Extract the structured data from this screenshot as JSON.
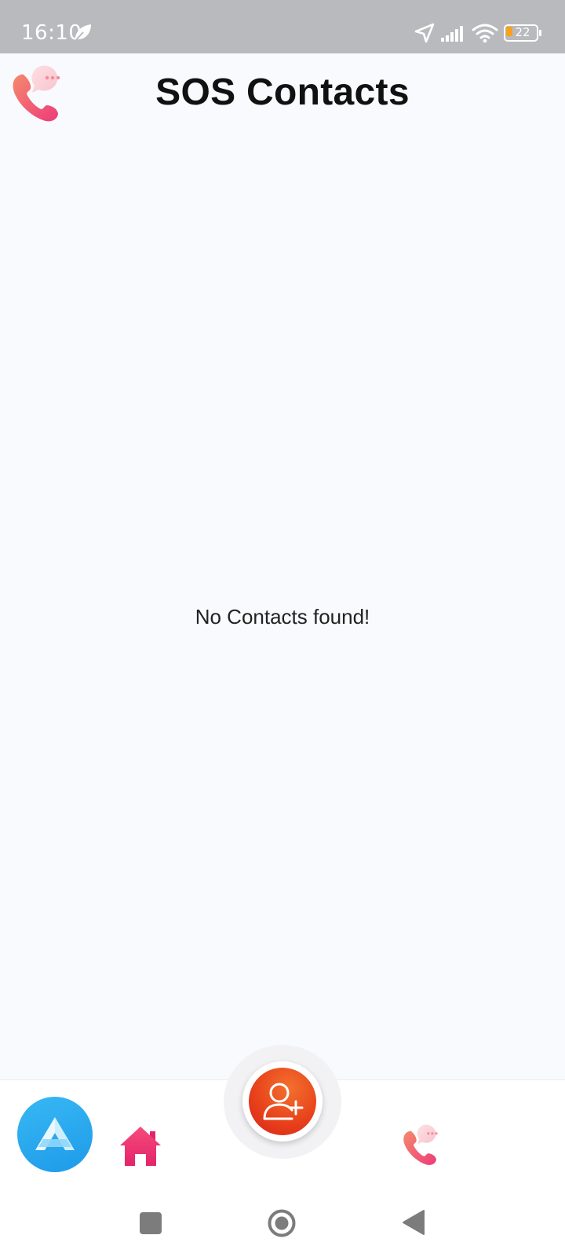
{
  "status_bar": {
    "time": "16:10",
    "battery_level": "22",
    "icons": [
      "leaf-icon",
      "location-arrow-icon",
      "signal-icon",
      "wifi-icon",
      "battery-icon"
    ],
    "battery_fill_color": "#f7a21b"
  },
  "header": {
    "title": "SOS Contacts",
    "logo_icon": "phone-chat-icon"
  },
  "main": {
    "empty_message": "No Contacts found!"
  },
  "bottom_nav": {
    "items": [
      {
        "icon": "app-launcher-icon"
      },
      {
        "icon": "home-icon"
      },
      {
        "icon": "add-contact-icon"
      },
      {
        "icon": "phone-chat-icon"
      }
    ],
    "colors": {
      "fab_accent": "#e8431b",
      "home": "#f0306c",
      "launcher": "#2aa6ee",
      "phone": "#f06b8a"
    }
  },
  "system_nav": {
    "buttons": [
      "recents-button",
      "home-button",
      "back-button"
    ]
  }
}
